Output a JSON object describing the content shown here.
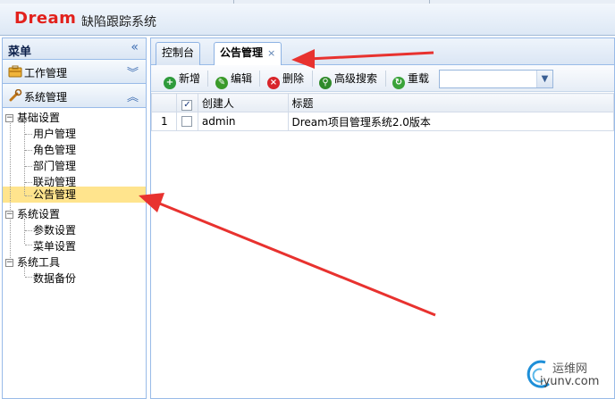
{
  "header": {
    "logo": "Dream",
    "title": "缺陷跟踪系统"
  },
  "sidebar": {
    "title": "菜单",
    "collapse_glyph": "«",
    "panels": [
      {
        "label": "工作管理",
        "toggle": "︾"
      },
      {
        "label": "系统管理",
        "toggle": "︽"
      }
    ],
    "tree": [
      {
        "label": "基础设置",
        "toggle": "⊟"
      },
      {
        "label": "用户管理"
      },
      {
        "label": "角色管理"
      },
      {
        "label": "部门管理"
      },
      {
        "label": "联动管理"
      },
      {
        "label": "公告管理"
      },
      {
        "label": "系统设置",
        "toggle": "⊟"
      },
      {
        "label": "参数设置"
      },
      {
        "label": "菜单设置"
      },
      {
        "label": "系统工具",
        "toggle": "⊟"
      },
      {
        "label": "数据备份"
      }
    ],
    "selected": "公告管理"
  },
  "tabs": [
    {
      "label": "控制台"
    },
    {
      "label": "公告管理",
      "close": "×"
    }
  ],
  "toolbar": {
    "add": "新增",
    "edit": "编辑",
    "delete": "删除",
    "search": "高级搜索",
    "reload": "重载",
    "combo_value": "",
    "combo_arrow": "▼"
  },
  "grid": {
    "headers": [
      "创建人",
      "标题"
    ],
    "rows": [
      {
        "num": "1",
        "creator": "admin",
        "title": "Dream项目管理系统2.0版本"
      }
    ]
  },
  "watermark": {
    "line1": "运维网",
    "line2": "iyunv.com"
  },
  "colors": {
    "logo": "#e2211c",
    "selected_row": "#ffe48d",
    "arrow": "#e8322f",
    "border": "#99bbe8"
  }
}
